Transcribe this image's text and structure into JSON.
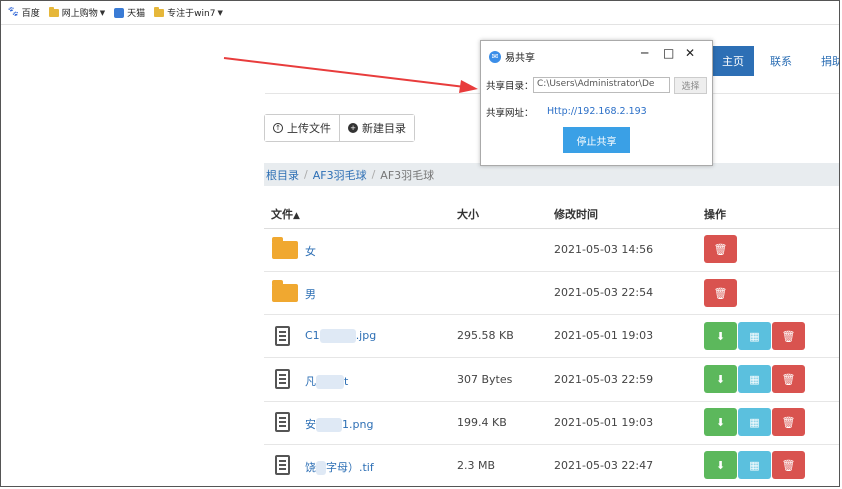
{
  "bookmarks": [
    {
      "label": "百度",
      "icon": "paw-icon"
    },
    {
      "label": "网上购物",
      "icon": "folder-icon",
      "dropdown": true
    },
    {
      "label": "天猫",
      "icon": "tmall-icon"
    },
    {
      "label": "专注于win7",
      "icon": "folder-icon",
      "dropdown": true
    }
  ],
  "nav": {
    "home": "主页",
    "contact": "联系",
    "donate": "捐助"
  },
  "toolbar": {
    "upload": "上传文件",
    "new_folder": "新建目录"
  },
  "breadcrumb": [
    "根目录",
    "AF3羽毛球",
    "AF3羽毛球"
  ],
  "table": {
    "headers": {
      "name": "文件",
      "sort_arrow": "▲",
      "size": "大小",
      "modified": "修改时间",
      "actions": "操作"
    },
    "rows": [
      {
        "name": "女",
        "size": "",
        "modified": "2021-05-03 14:56",
        "type": "folder"
      },
      {
        "name": "男",
        "size": "",
        "modified": "2021-05-03 22:54",
        "type": "folder"
      },
      {
        "name_start": "C1",
        "name_end": ".jpg",
        "size": "295.58 KB",
        "modified": "2021-05-01 19:03",
        "type": "file"
      },
      {
        "name_start": "凡",
        "name_end": "t",
        "size": "307 Bytes",
        "modified": "2021-05-03 22:59",
        "type": "file"
      },
      {
        "name_start": "安",
        "name_end": "1.png",
        "size": "199.4 KB",
        "modified": "2021-05-01 19:03",
        "type": "file"
      },
      {
        "name_start": "饶",
        "name_end": "字母）.tif",
        "size": "2.3 MB",
        "modified": "2021-05-03 22:47",
        "type": "file"
      }
    ]
  },
  "popup": {
    "title": "易共享",
    "dir_label": "共享目录：",
    "dir_value": "C:\\Users\\Administrator\\De",
    "select_button": "选择",
    "url_label": "共享网址：",
    "url_value": "Http://192.168.2.193",
    "stop_button": "停止共享"
  },
  "annotation": {
    "arrow_color": "#e83c3c"
  }
}
